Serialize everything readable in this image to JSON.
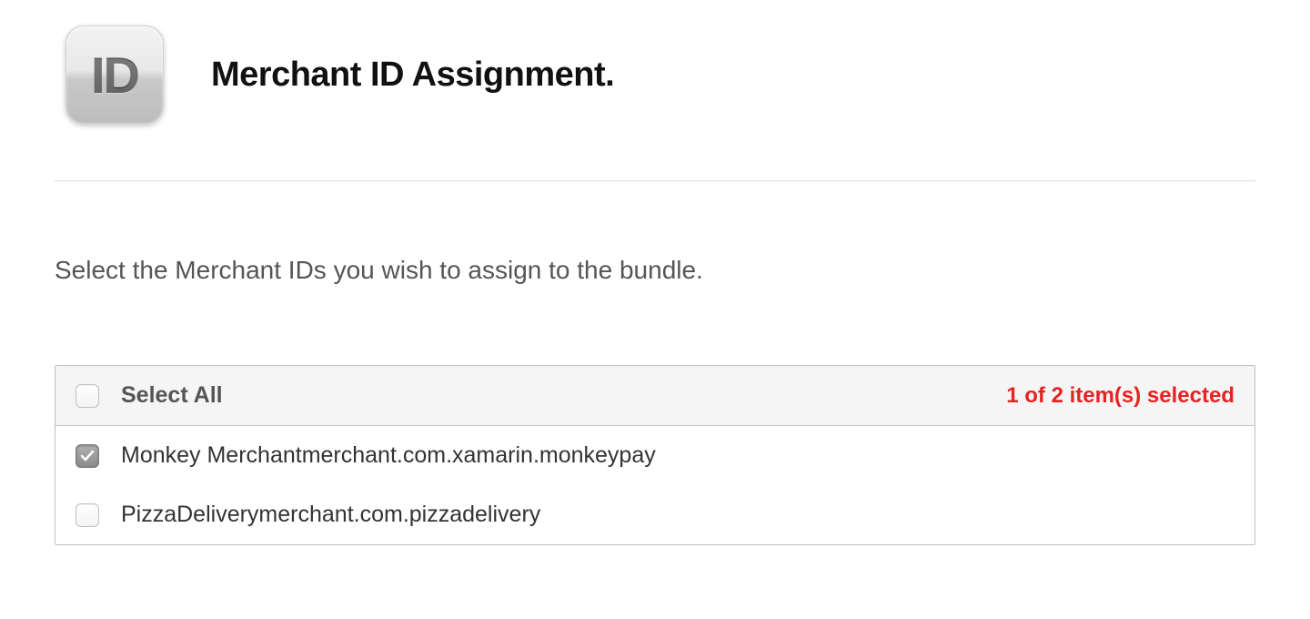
{
  "header": {
    "icon_text": "ID",
    "title": "Merchant ID Assignment."
  },
  "instruction": "Select the Merchant IDs you wish to assign to the bundle.",
  "table": {
    "select_all_label": "Select All",
    "selection_count": "1 of 2 item(s) selected",
    "rows": [
      {
        "label": "Monkey Merchantmerchant.com.xamarin.monkeypay",
        "checked": true
      },
      {
        "label": "PizzaDeliverymerchant.com.pizzadelivery",
        "checked": false
      }
    ]
  }
}
